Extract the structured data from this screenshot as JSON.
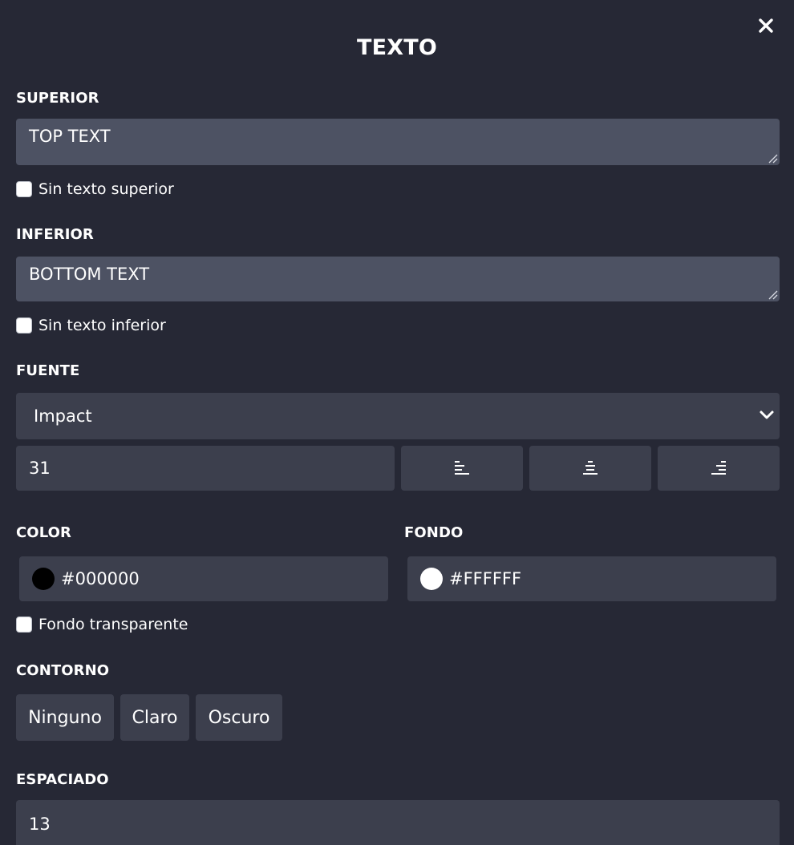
{
  "dialog": {
    "title": "TEXTO"
  },
  "top": {
    "label": "SUPERIOR",
    "value": "TOP TEXT",
    "no_text_label": "Sin texto superior",
    "no_text_checked": false
  },
  "bottom": {
    "label": "INFERIOR",
    "value": "BOTTOM TEXT",
    "no_text_label": "Sin texto inferior",
    "no_text_checked": false
  },
  "font": {
    "label": "FUENTE",
    "selected": "Impact",
    "size": "31",
    "align_options": [
      "align-left",
      "align-center",
      "align-right"
    ]
  },
  "color": {
    "label": "COLOR",
    "value": "#000000"
  },
  "background": {
    "label": "FONDO",
    "value": "#FFFFFF",
    "transparent_label": "Fondo transparente",
    "transparent_checked": false
  },
  "outline": {
    "label": "CONTORNO",
    "options": [
      "Ninguno",
      "Claro",
      "Oscuro"
    ]
  },
  "spacing": {
    "label": "ESPACIADO",
    "value": "13"
  },
  "colors": {
    "background": "#262835",
    "field": "#3c3f4d",
    "textarea": "#4d5263",
    "text": "#ffffff"
  }
}
